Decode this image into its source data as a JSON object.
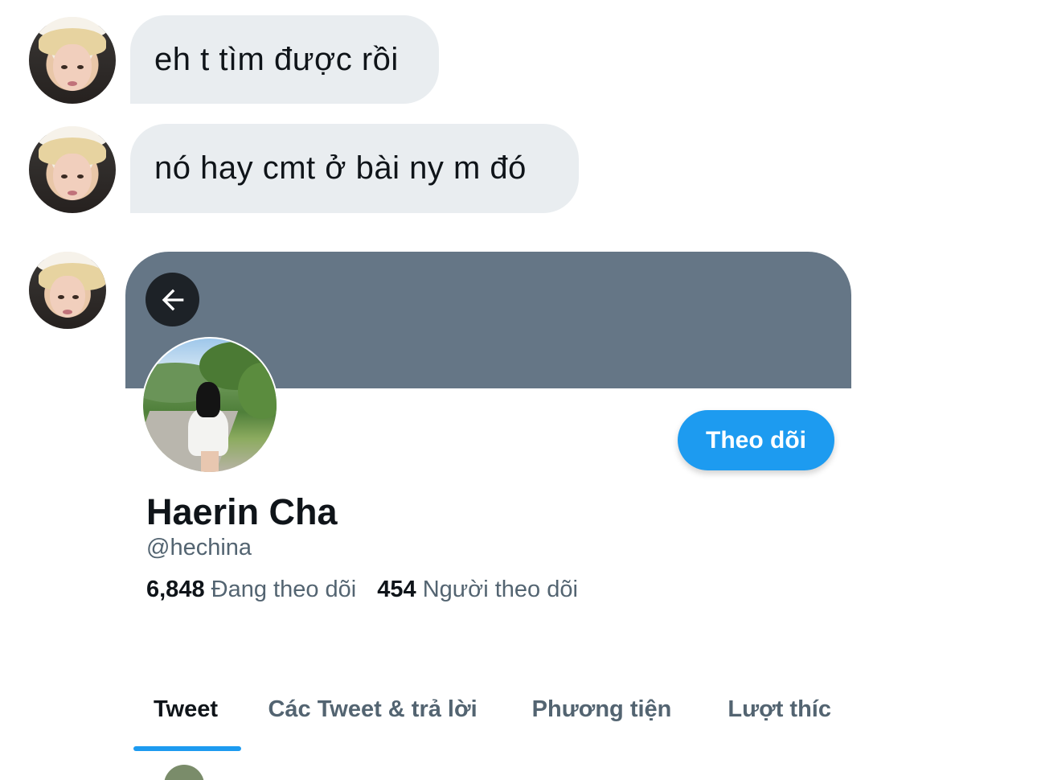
{
  "messages": [
    {
      "text": "eh t tìm được rồi"
    },
    {
      "text": "nó hay cmt ở bài ny m đó"
    }
  ],
  "profile_card": {
    "display_name": "Haerin Cha",
    "handle": "@hechina",
    "follow_label": "Theo dõi",
    "following_count": "6,848",
    "following_label": "Đang theo dõi",
    "followers_count": "454",
    "followers_label": "Người theo dõi",
    "banner_color": "#657686",
    "tabs": [
      {
        "label": "Tweet",
        "active": true
      },
      {
        "label": "Các Tweet & trả lời",
        "active": false
      },
      {
        "label": "Phương tiện",
        "active": false
      },
      {
        "label": "Lượt thíc",
        "active": false
      }
    ],
    "accent_color": "#1d9bf0"
  },
  "icons": {
    "back": "arrow-left-icon"
  }
}
